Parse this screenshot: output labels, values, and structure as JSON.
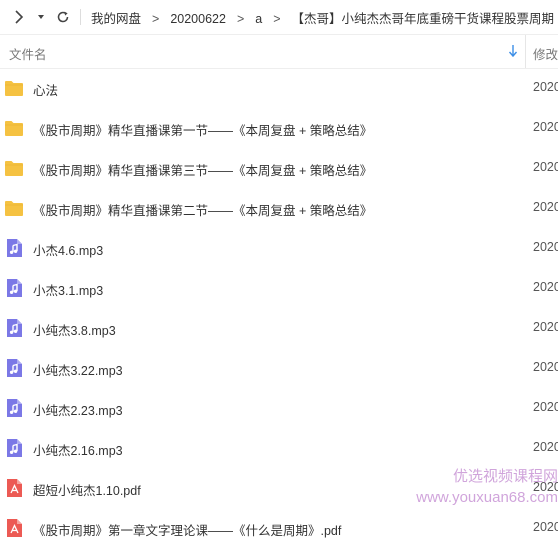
{
  "breadcrumb": {
    "items": [
      "我的网盘",
      "20200622",
      "a",
      "【杰哥】小纯杰杰哥年底重磅干货课程股票周期"
    ],
    "separator": ">"
  },
  "table": {
    "header_name": "文件名",
    "header_modified": "修改"
  },
  "files": [
    {
      "name": "心法",
      "icon": "folder-icon",
      "date": "2020"
    },
    {
      "name": "《股市周期》精华直播课第一节——《本周复盘 + 策略总结》",
      "icon": "folder-icon",
      "date": "2020"
    },
    {
      "name": "《股市周期》精华直播课第三节——《本周复盘 + 策略总结》",
      "icon": "folder-icon",
      "date": "2020"
    },
    {
      "name": "《股市周期》精华直播课第二节——《本周复盘 + 策略总结》",
      "icon": "folder-icon",
      "date": "2020"
    },
    {
      "name": "小杰4.6.mp3",
      "icon": "audio-file-icon",
      "date": "2020"
    },
    {
      "name": "小杰3.1.mp3",
      "icon": "audio-file-icon",
      "date": "2020"
    },
    {
      "name": "小纯杰3.8.mp3",
      "icon": "audio-file-icon",
      "date": "2020"
    },
    {
      "name": "小纯杰3.22.mp3",
      "icon": "audio-file-icon",
      "date": "2020"
    },
    {
      "name": "小纯杰2.23.mp3",
      "icon": "audio-file-icon",
      "date": "2020"
    },
    {
      "name": "小纯杰2.16.mp3",
      "icon": "audio-file-icon",
      "date": "2020"
    },
    {
      "name": "超短小纯杰1.10.pdf",
      "icon": "pdf-file-icon",
      "date": "2020"
    },
    {
      "name": "《股市周期》第一章文字理论课——《什么是周期》.pdf",
      "icon": "pdf-file-icon",
      "date": "2020"
    }
  ],
  "watermark": {
    "line1": "优选视频课程网",
    "line2": "www.youxuan68.com"
  },
  "colors": {
    "folder": "#f5c242",
    "audio": "#7b78e6",
    "pdf": "#ec5a54",
    "accent": "#3c8ee6"
  }
}
